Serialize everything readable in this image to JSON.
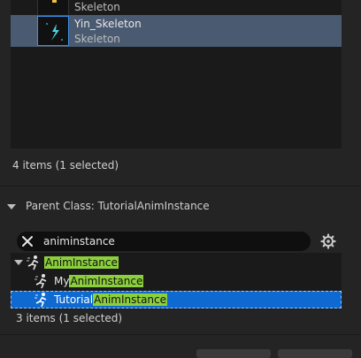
{
  "skeleton_list": {
    "items": [
      {
        "name": "",
        "type": "Skeleton"
      },
      {
        "name": "Yin_Skeleton",
        "type": "Skeleton"
      }
    ],
    "count_text": "4 items (1 selected)"
  },
  "parent_class": {
    "header": "Parent Class: TutorialAnimInstance",
    "search_value": "animinstance",
    "items": [
      {
        "prefix": "",
        "match": "AnimInstance",
        "suffix": ""
      },
      {
        "prefix": "My",
        "match": "AnimInstance",
        "suffix": ""
      },
      {
        "prefix": "Tutorial",
        "match": "AnimInstance",
        "suffix": ""
      }
    ],
    "count_text": "3 items (1 selected)"
  },
  "colors": {
    "selection_row": "#4a5a70",
    "class_selection": "#0e6ad1",
    "match_highlight": "#8ccf3c",
    "thumb_accent": "#3a8ee6"
  },
  "icons": [
    "clear-search-icon",
    "settings-gear-icon",
    "anim-blueprint-icon",
    "skeleton-thumbnail-icon",
    "expand-arrow-icon"
  ]
}
